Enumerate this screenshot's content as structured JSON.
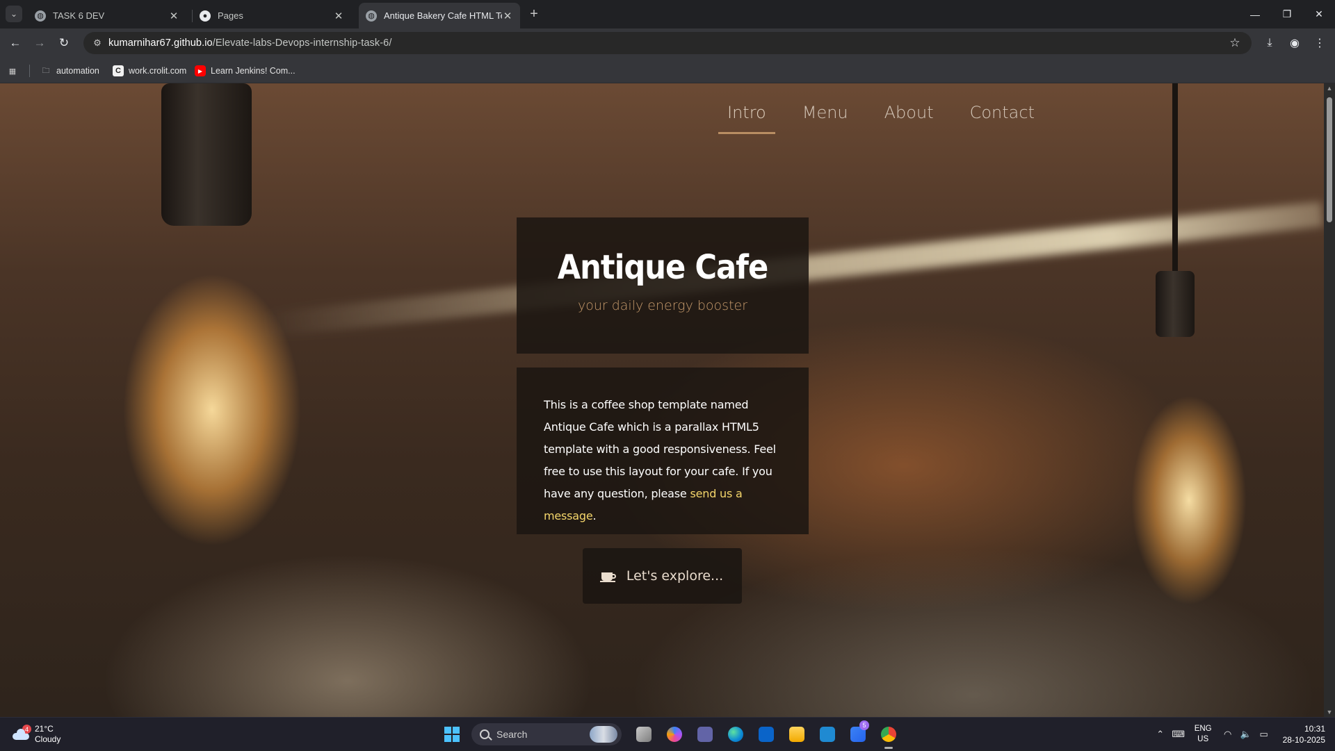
{
  "browser": {
    "tabs": [
      {
        "title": "TASK 6 DEV",
        "active": false
      },
      {
        "title": "Pages",
        "active": false
      },
      {
        "title": "Antique Bakery Cafe HTML Tem",
        "active": true
      }
    ],
    "url_host": "kumarnihar67.github.io",
    "url_path": "/Elevate-labs-Devops-internship-task-6/",
    "bookmarks": [
      {
        "label": "automation",
        "icon": "folder-icon"
      },
      {
        "label": "work.crolit.com",
        "icon": "crolit-icon"
      },
      {
        "label": "Learn Jenkins! Com...",
        "icon": "youtube-icon"
      }
    ]
  },
  "site": {
    "nav": [
      "Intro",
      "Menu",
      "About",
      "Contact"
    ],
    "active_nav": "Intro",
    "title": "Antique Cafe",
    "subtitle": "your daily energy booster",
    "intro_text": "This is a coffee shop template named Antique Cafe which is a parallax HTML5 template with a good responsiveness. Feel free to use this layout for your cafe. If you have any question, please ",
    "intro_link": "send us a message",
    "intro_end": ".",
    "cta_label": "Let's explore...",
    "colors": {
      "accent": "#c79b6c",
      "link": "#f5d66b",
      "panel": "#1c1612"
    }
  },
  "taskbar": {
    "weather_temp": "21°C",
    "weather_desc": "Cloudy",
    "weather_badge": "4",
    "search_placeholder": "Search",
    "todo_badge": "5",
    "lang_top": "ENG",
    "lang_bottom": "US",
    "time": "10:31",
    "date": "28-10-2025"
  }
}
